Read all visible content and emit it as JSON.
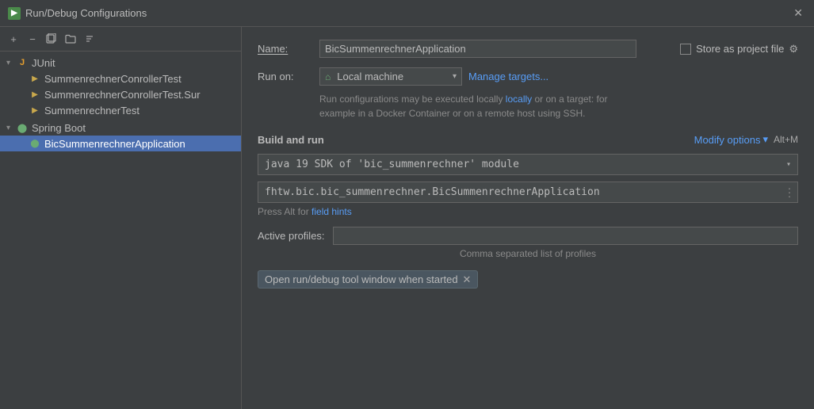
{
  "titleBar": {
    "icon": "▶",
    "title": "Run/Debug Configurations",
    "closeLabel": "✕"
  },
  "toolbar": {
    "addLabel": "+",
    "removeLabel": "−",
    "copyLabel": "⧉",
    "folderLabel": "📁",
    "sortLabel": "↕"
  },
  "tree": {
    "items": [
      {
        "id": "junit",
        "label": "JUnit",
        "level": 0,
        "type": "junit",
        "expanded": true,
        "isGroup": true
      },
      {
        "id": "test1",
        "label": "SummenrechnerConrollerTest",
        "level": 1,
        "type": "test"
      },
      {
        "id": "test2",
        "label": "SummenrechnerConrollerTest.Sur",
        "level": 1,
        "type": "test"
      },
      {
        "id": "test3",
        "label": "SummenrechnerTest",
        "level": 1,
        "type": "test"
      },
      {
        "id": "springboot",
        "label": "Spring Boot",
        "level": 0,
        "type": "springboot",
        "expanded": true,
        "isGroup": true
      },
      {
        "id": "app",
        "label": "BicSummenrechnerApplication",
        "level": 1,
        "type": "app",
        "selected": true
      }
    ]
  },
  "form": {
    "nameLabel": "Name:",
    "nameValue": "BicSummenrechnerApplication",
    "namePlaceholder": "",
    "storeLabel": "Store as project file",
    "runOnLabel": "Run on:",
    "runOnValue": "Local machine",
    "manageTargetsLabel": "Manage targets...",
    "infoText1": "Run configurations may be executed locally",
    "infoText2": " or on a target: for",
    "infoText3": "example in a Docker Container or on a remote host using SSH.",
    "buildRunTitle": "Build and run",
    "modifyOptionsLabel": "Modify options",
    "modifyOptionsShortcut": "Alt+M",
    "sdkValue": "java 19  SDK of 'bic_summenrechner' module",
    "mainClassValue": "fhtw.bic.bic_summenrechner.BicSummenrechnerApplication",
    "fieldHintsText": "Press Alt for",
    "fieldHintsLink": "field hints",
    "activeProfilesLabel": "Active profiles:",
    "activeProfilesPlaceholder": "",
    "profilesHint": "Comma separated list of profiles",
    "openToolWindowLabel": "Open run/debug tool window when started"
  }
}
